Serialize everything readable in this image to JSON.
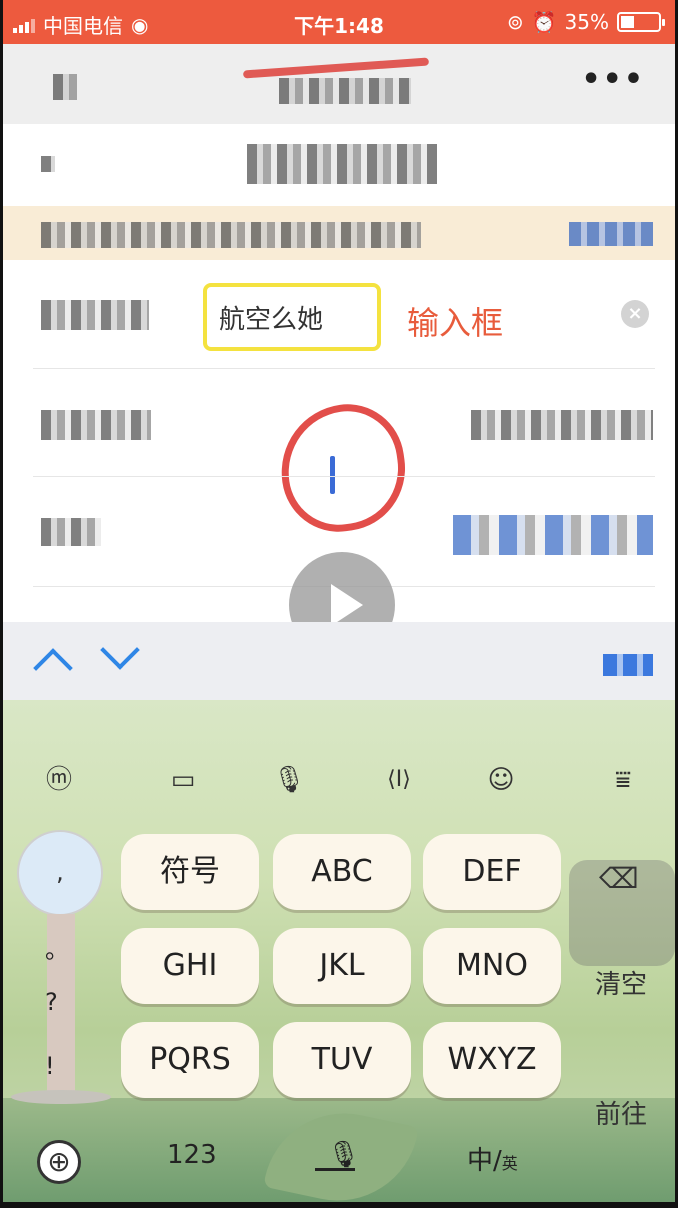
{
  "status_bar": {
    "carrier": "中国电信",
    "time": "下午1:48",
    "battery_percent": "35%",
    "battery_level": 0.35,
    "icons": [
      "signal-icon",
      "wifi-icon",
      "rotation-lock-icon",
      "alarm-icon",
      "battery-icon"
    ]
  },
  "nav": {
    "more_label": "•••"
  },
  "form": {
    "name_value": "航空么她",
    "annotation": "输入框",
    "clear_icon": "×"
  },
  "toolbar": {
    "icons": [
      "up-arrow-icon",
      "down-arrow-icon"
    ]
  },
  "keyboard": {
    "tool_icons": [
      "ime-icon",
      "chat-icon",
      "microphone-icon",
      "cursor-icon",
      "emoji-icon",
      "hide-keyboard-icon"
    ],
    "tool_glyphs": [
      "ⓜ",
      "▭",
      "🎙",
      "⟨I⟩",
      "☺",
      "⩸"
    ],
    "punctuation": [
      ",",
      "。",
      "?",
      "!"
    ],
    "keys": [
      [
        "符号",
        "ABC",
        "DEF"
      ],
      [
        "GHI",
        "JKL",
        "MNO"
      ],
      [
        "PQRS",
        "TUV",
        "WXYZ"
      ]
    ],
    "backspace_icon": "⌫",
    "clear_label": "清空",
    "go_label": "前往",
    "numeric_label": "123",
    "lang_label": "中/",
    "lang_sub": "英",
    "globe_icon": "⊕",
    "mic_glyph": "🎙"
  },
  "colors": {
    "status_bg": "#ed5a3e",
    "highlight_box": "#f4e23f",
    "annotation": "#e85c3c",
    "caret": "#3b6bd6",
    "chevron": "#2f86e6"
  }
}
